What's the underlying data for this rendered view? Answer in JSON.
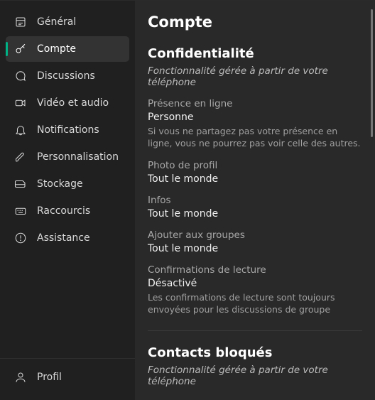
{
  "sidebar": {
    "items": [
      {
        "label": "Général",
        "icon": "settings-icon"
      },
      {
        "label": "Compte",
        "icon": "key-icon",
        "active": true
      },
      {
        "label": "Discussions",
        "icon": "chat-icon"
      },
      {
        "label": "Vidéo et audio",
        "icon": "video-icon"
      },
      {
        "label": "Notifications",
        "icon": "bell-icon"
      },
      {
        "label": "Personnalisation",
        "icon": "brush-icon"
      },
      {
        "label": "Stockage",
        "icon": "storage-icon"
      },
      {
        "label": "Raccourcis",
        "icon": "keyboard-icon"
      },
      {
        "label": "Assistance",
        "icon": "help-icon"
      }
    ],
    "bottom": {
      "label": "Profil",
      "icon": "profile-icon"
    }
  },
  "main": {
    "title": "Compte",
    "privacy": {
      "heading": "Confidentialité",
      "subtitle": "Fonctionnalité gérée à partir de votre téléphone",
      "settings": [
        {
          "label": "Présence en ligne",
          "value": "Personne",
          "desc": "Si vous ne partagez pas votre présence en ligne, vous ne pourrez pas voir celle des autres."
        },
        {
          "label": "Photo de profil",
          "value": "Tout le monde"
        },
        {
          "label": "Infos",
          "value": "Tout le monde"
        },
        {
          "label": "Ajouter aux groupes",
          "value": "Tout le monde"
        },
        {
          "label": "Confirmations de lecture",
          "value": "Désactivé",
          "desc": "Les confirmations de lecture sont toujours envoyées pour les discussions de groupe"
        }
      ]
    },
    "blocked": {
      "heading": "Contacts bloqués",
      "subtitle": "Fonctionnalité gérée à partir de votre téléphone"
    }
  }
}
